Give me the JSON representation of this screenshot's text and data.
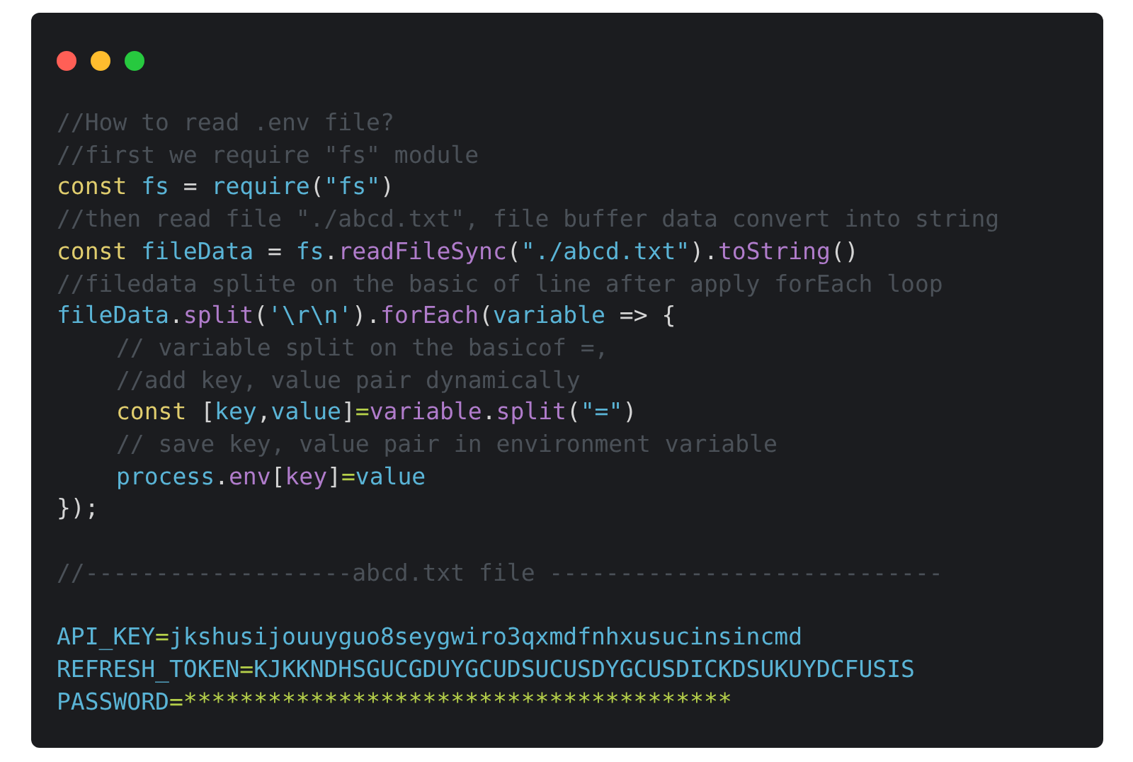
{
  "window": {
    "controls": [
      {
        "color": "#ff5f56"
      },
      {
        "color": "#ffbd2e"
      },
      {
        "color": "#27c93f"
      }
    ]
  },
  "code_lines": [
    {
      "kind": "code",
      "indented": false,
      "tokens": [
        {
          "t": "//How to read .env file?",
          "kind": "comment"
        }
      ]
    },
    {
      "kind": "code",
      "indented": false,
      "tokens": [
        {
          "t": "//first we require \"fs\" module",
          "kind": "comment"
        }
      ]
    },
    {
      "kind": "code",
      "indented": false,
      "tokens": [
        {
          "t": "const ",
          "kind": "keyword"
        },
        {
          "t": "fs ",
          "kind": "ident"
        },
        {
          "t": "= ",
          "kind": "punct"
        },
        {
          "t": "require",
          "kind": "ident"
        },
        {
          "t": "(",
          "kind": "punct"
        },
        {
          "t": "\"fs\"",
          "kind": "string"
        },
        {
          "t": ")",
          "kind": "punct"
        }
      ]
    },
    {
      "kind": "code",
      "indented": false,
      "tokens": [
        {
          "t": "//then read file \"./abcd.txt\", file buffer data convert into string",
          "kind": "comment"
        }
      ]
    },
    {
      "kind": "code",
      "indented": false,
      "tokens": [
        {
          "t": "const ",
          "kind": "keyword"
        },
        {
          "t": "fileData ",
          "kind": "ident"
        },
        {
          "t": "= ",
          "kind": "punct"
        },
        {
          "t": "fs",
          "kind": "ident"
        },
        {
          "t": ".",
          "kind": "punct"
        },
        {
          "t": "readFileSync",
          "kind": "func"
        },
        {
          "t": "(",
          "kind": "punct"
        },
        {
          "t": "\"./abcd.txt\"",
          "kind": "string"
        },
        {
          "t": ").",
          "kind": "punct"
        },
        {
          "t": "toString",
          "kind": "func"
        },
        {
          "t": "()",
          "kind": "punct"
        }
      ]
    },
    {
      "kind": "code",
      "indented": false,
      "tokens": [
        {
          "t": "//filedata splite on the basic of line after apply forEach loop",
          "kind": "comment"
        }
      ]
    },
    {
      "kind": "code",
      "indented": false,
      "tokens": [
        {
          "t": "fileData",
          "kind": "ident"
        },
        {
          "t": ".",
          "kind": "punct"
        },
        {
          "t": "split",
          "kind": "func"
        },
        {
          "t": "(",
          "kind": "punct"
        },
        {
          "t": "'\\r\\n'",
          "kind": "string"
        },
        {
          "t": ").",
          "kind": "punct"
        },
        {
          "t": "forEach",
          "kind": "func"
        },
        {
          "t": "(",
          "kind": "punct"
        },
        {
          "t": "variable",
          "kind": "ident"
        },
        {
          "t": " => {",
          "kind": "punct"
        }
      ]
    },
    {
      "kind": "code",
      "indented": true,
      "tokens": [
        {
          "t": "// variable split on the basicof =,",
          "kind": "comment"
        }
      ]
    },
    {
      "kind": "code",
      "indented": true,
      "tokens": [
        {
          "t": "//add key, value pair dynamically",
          "kind": "comment"
        }
      ]
    },
    {
      "kind": "code",
      "indented": true,
      "tokens": [
        {
          "t": "const ",
          "kind": "keyword"
        },
        {
          "t": "[",
          "kind": "punct"
        },
        {
          "t": "key",
          "kind": "ident"
        },
        {
          "t": ",",
          "kind": "punct"
        },
        {
          "t": "value",
          "kind": "ident"
        },
        {
          "t": "]",
          "kind": "punct"
        },
        {
          "t": "=",
          "kind": "operator"
        },
        {
          "t": "variable",
          "kind": "func"
        },
        {
          "t": ".",
          "kind": "punct"
        },
        {
          "t": "split",
          "kind": "func"
        },
        {
          "t": "(",
          "kind": "punct"
        },
        {
          "t": "\"=\"",
          "kind": "string"
        },
        {
          "t": ")",
          "kind": "punct"
        }
      ]
    },
    {
      "kind": "code",
      "indented": true,
      "tokens": [
        {
          "t": "// save key, value pair in environment variable",
          "kind": "comment"
        }
      ]
    },
    {
      "kind": "code",
      "indented": true,
      "tokens": [
        {
          "t": "process",
          "kind": "ident"
        },
        {
          "t": ".",
          "kind": "punct"
        },
        {
          "t": "env",
          "kind": "func"
        },
        {
          "t": "[",
          "kind": "punct"
        },
        {
          "t": "key",
          "kind": "func"
        },
        {
          "t": "]",
          "kind": "punct"
        },
        {
          "t": "=",
          "kind": "operator"
        },
        {
          "t": "value",
          "kind": "ident"
        }
      ]
    },
    {
      "kind": "code",
      "indented": false,
      "tokens": [
        {
          "t": "});",
          "kind": "punct"
        }
      ]
    },
    {
      "kind": "blank"
    },
    {
      "kind": "code",
      "indented": false,
      "tokens": [
        {
          "t": "//-------------------abcd.txt file ----------------------------",
          "kind": "comment"
        }
      ]
    },
    {
      "kind": "blank"
    },
    {
      "kind": "code",
      "indented": false,
      "tokens": [
        {
          "t": "API_KEY",
          "kind": "ident"
        },
        {
          "t": "=",
          "kind": "operator"
        },
        {
          "t": "jkshusijouuyguo8seygwiro3qxmdfnhxusucinsincmd",
          "kind": "ident"
        }
      ]
    },
    {
      "kind": "code",
      "indented": false,
      "tokens": [
        {
          "t": "REFRESH_TOKEN",
          "kind": "ident"
        },
        {
          "t": "=",
          "kind": "operator"
        },
        {
          "t": "KJKKNDHSGUCGDUYGCUDSUCUSDYGCUSDICKDSUKUYDCFUSIS",
          "kind": "ident"
        }
      ]
    },
    {
      "kind": "code",
      "indented": false,
      "tokens": [
        {
          "t": "PASSWORD",
          "kind": "ident"
        },
        {
          "t": "=",
          "kind": "operator"
        },
        {
          "t": "***************************************",
          "kind": "operator"
        }
      ]
    }
  ]
}
